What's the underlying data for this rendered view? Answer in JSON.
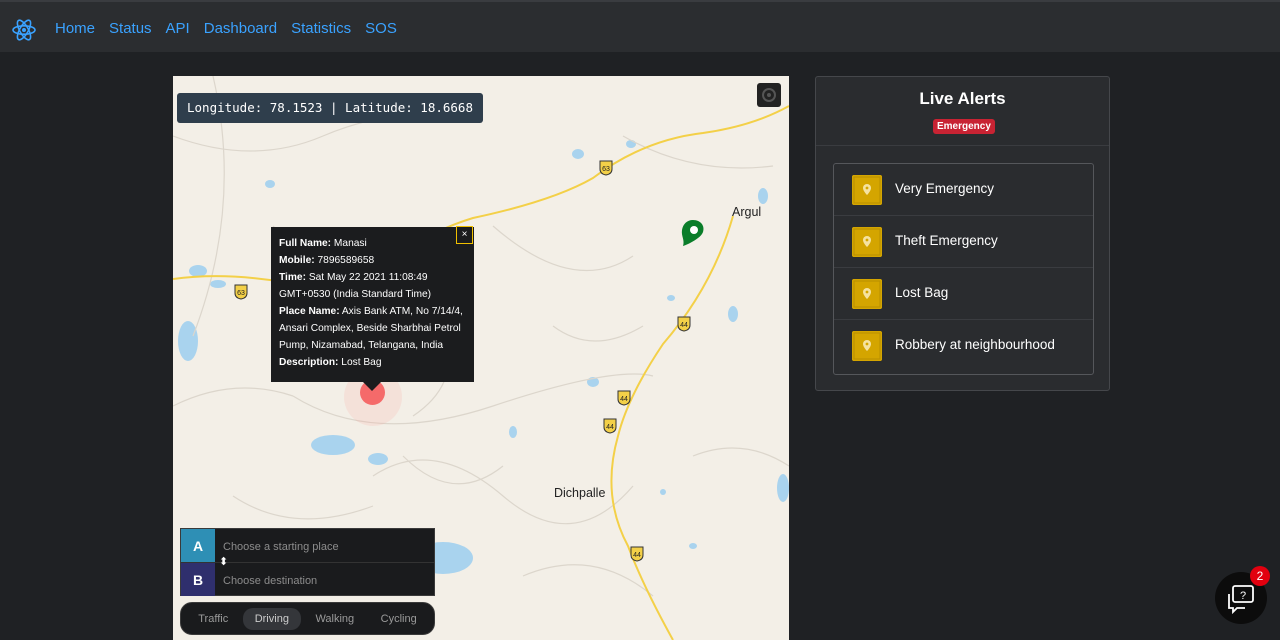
{
  "nav": {
    "links": [
      "Home",
      "Status",
      "API",
      "Dashboard",
      "Statistics",
      "SOS"
    ]
  },
  "map": {
    "coords": "Longitude: 78.1523 | Latitude: 18.6668",
    "towns": {
      "argul": "Argul",
      "dichpalle": "Dichpalle"
    },
    "shields": [
      "63",
      "63",
      "44",
      "44",
      "44",
      "44"
    ],
    "popup": {
      "name_label": "Full Name:",
      "name": "Manasi",
      "mobile_label": "Mobile:",
      "mobile": "7896589658",
      "time_label": "Time:",
      "time": "Sat May 22 2021 11:08:49 GMT+0530 (India Standard Time)",
      "place_label": "Place Name:",
      "place": "Axis Bank ATM, No 7/14/4, Ansari Complex, Beside Sharbhai Petrol Pump, Nizamabad, Telangana, India",
      "desc_label": "Description:",
      "desc": "Lost Bag",
      "close": "×"
    },
    "directions": {
      "a_label": "A",
      "b_label": "B",
      "start_placeholder": "Choose a starting place",
      "dest_placeholder": "Choose destination",
      "modes": [
        "Traffic",
        "Driving",
        "Walking",
        "Cycling"
      ],
      "active_mode": "Driving"
    },
    "colors": {
      "marker_red": "#f56a6a",
      "pin_green": "#0a7d2a",
      "water": "#a9d3ee",
      "road_yellow": "#f3d048"
    }
  },
  "alerts": {
    "title": "Live Alerts",
    "badge": "Emergency",
    "items": [
      "Very Emergency",
      "Theft Emergency",
      "Lost Bag",
      "Robbery at neighbourhood"
    ]
  },
  "chat": {
    "count": "2"
  }
}
